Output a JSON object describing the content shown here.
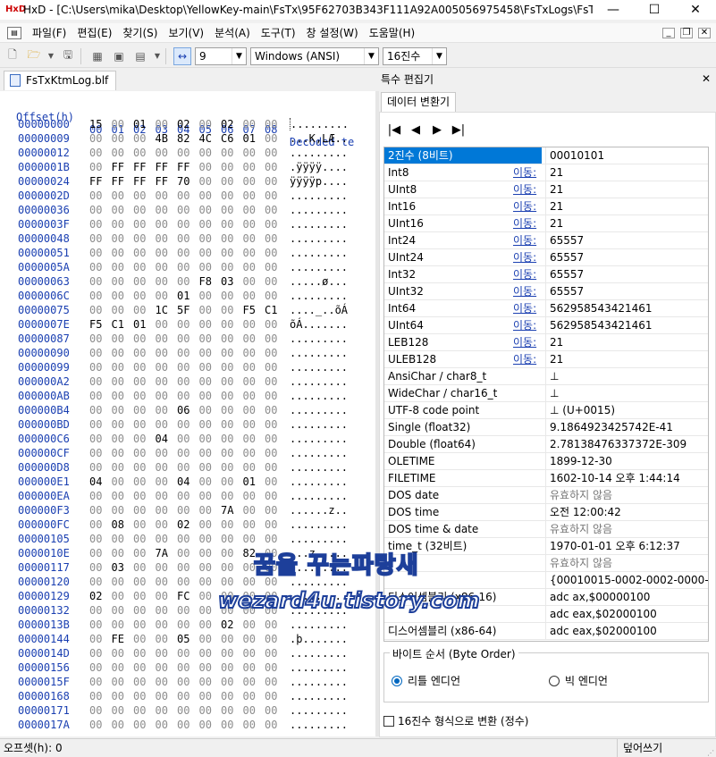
{
  "window": {
    "title": "HxD - [C:\\Users\\mika\\Desktop\\YellowKey-main\\FsTx\\95F62703B343F111A92A005056975458\\FsTxLogs\\FsTxKtmLog.blf]",
    "app_icon_label": "HxD",
    "minimize_glyph": "—",
    "maximize_glyph": "☐",
    "close_glyph": "✕"
  },
  "menu": {
    "items": [
      "파일(F)",
      "편집(E)",
      "찾기(S)",
      "보기(V)",
      "분석(A)",
      "도구(T)",
      "창 설정(W)",
      "도움말(H)"
    ],
    "mdi": [
      "_",
      "❐",
      "✕"
    ]
  },
  "toolbar": {
    "bytes_per_row": "9",
    "charset": "Windows (ANSI)",
    "offset_base": "16진수"
  },
  "document": {
    "tab_label": "FsTxKtmLog.blf"
  },
  "hex": {
    "header_offset": "Offset(h)",
    "header_columns": [
      "00",
      "01",
      "02",
      "03",
      "04",
      "05",
      "06",
      "07",
      "08"
    ],
    "header_decoded": "Decoded te",
    "rows": [
      {
        "o": "00000000",
        "b": [
          "15",
          "00",
          "01",
          "00",
          "02",
          "00",
          "02",
          "00",
          "00"
        ],
        "t": "........."
      },
      {
        "o": "00000009",
        "b": [
          "00",
          "00",
          "00",
          "4B",
          "82",
          "4C",
          "C6",
          "01",
          "00"
        ],
        "t": "...K,LÆ.."
      },
      {
        "o": "00000012",
        "b": [
          "00",
          "00",
          "00",
          "00",
          "00",
          "00",
          "00",
          "00",
          "00"
        ],
        "t": "........."
      },
      {
        "o": "0000001B",
        "b": [
          "00",
          "FF",
          "FF",
          "FF",
          "FF",
          "00",
          "00",
          "00",
          "00"
        ],
        "t": ".ÿÿÿÿ...."
      },
      {
        "o": "00000024",
        "b": [
          "FF",
          "FF",
          "FF",
          "FF",
          "70",
          "00",
          "00",
          "00",
          "00"
        ],
        "t": "ÿÿÿÿp...."
      },
      {
        "o": "0000002D",
        "b": [
          "00",
          "00",
          "00",
          "00",
          "00",
          "00",
          "00",
          "00",
          "00"
        ],
        "t": "........."
      },
      {
        "o": "00000036",
        "b": [
          "00",
          "00",
          "00",
          "00",
          "00",
          "00",
          "00",
          "00",
          "00"
        ],
        "t": "........."
      },
      {
        "o": "0000003F",
        "b": [
          "00",
          "00",
          "00",
          "00",
          "00",
          "00",
          "00",
          "00",
          "00"
        ],
        "t": "........."
      },
      {
        "o": "00000048",
        "b": [
          "00",
          "00",
          "00",
          "00",
          "00",
          "00",
          "00",
          "00",
          "00"
        ],
        "t": "........."
      },
      {
        "o": "00000051",
        "b": [
          "00",
          "00",
          "00",
          "00",
          "00",
          "00",
          "00",
          "00",
          "00"
        ],
        "t": "........."
      },
      {
        "o": "0000005A",
        "b": [
          "00",
          "00",
          "00",
          "00",
          "00",
          "00",
          "00",
          "00",
          "00"
        ],
        "t": "........."
      },
      {
        "o": "00000063",
        "b": [
          "00",
          "00",
          "00",
          "00",
          "00",
          "F8",
          "03",
          "00",
          "00"
        ],
        "t": ".....ø..."
      },
      {
        "o": "0000006C",
        "b": [
          "00",
          "00",
          "00",
          "00",
          "01",
          "00",
          "00",
          "00",
          "00"
        ],
        "t": "........."
      },
      {
        "o": "00000075",
        "b": [
          "00",
          "00",
          "00",
          "1C",
          "5F",
          "00",
          "00",
          "F5",
          "C1"
        ],
        "t": "...._..õÁ"
      },
      {
        "o": "0000007E",
        "b": [
          "F5",
          "C1",
          "01",
          "00",
          "00",
          "00",
          "00",
          "00",
          "00"
        ],
        "t": "õÁ......."
      },
      {
        "o": "00000087",
        "b": [
          "00",
          "00",
          "00",
          "00",
          "00",
          "00",
          "00",
          "00",
          "00"
        ],
        "t": "........."
      },
      {
        "o": "00000090",
        "b": [
          "00",
          "00",
          "00",
          "00",
          "00",
          "00",
          "00",
          "00",
          "00"
        ],
        "t": "........."
      },
      {
        "o": "00000099",
        "b": [
          "00",
          "00",
          "00",
          "00",
          "00",
          "00",
          "00",
          "00",
          "00"
        ],
        "t": "........."
      },
      {
        "o": "000000A2",
        "b": [
          "00",
          "00",
          "00",
          "00",
          "00",
          "00",
          "00",
          "00",
          "00"
        ],
        "t": "........."
      },
      {
        "o": "000000AB",
        "b": [
          "00",
          "00",
          "00",
          "00",
          "00",
          "00",
          "00",
          "00",
          "00"
        ],
        "t": "........."
      },
      {
        "o": "000000B4",
        "b": [
          "00",
          "00",
          "00",
          "00",
          "06",
          "00",
          "00",
          "00",
          "00"
        ],
        "t": "........."
      },
      {
        "o": "000000BD",
        "b": [
          "00",
          "00",
          "00",
          "00",
          "00",
          "00",
          "00",
          "00",
          "00"
        ],
        "t": "........."
      },
      {
        "o": "000000C6",
        "b": [
          "00",
          "00",
          "00",
          "04",
          "00",
          "00",
          "00",
          "00",
          "00"
        ],
        "t": "........."
      },
      {
        "o": "000000CF",
        "b": [
          "00",
          "00",
          "00",
          "00",
          "00",
          "00",
          "00",
          "00",
          "00"
        ],
        "t": "........."
      },
      {
        "o": "000000D8",
        "b": [
          "00",
          "00",
          "00",
          "00",
          "00",
          "00",
          "00",
          "00",
          "00"
        ],
        "t": "........."
      },
      {
        "o": "000000E1",
        "b": [
          "04",
          "00",
          "00",
          "00",
          "04",
          "00",
          "00",
          "01",
          "00"
        ],
        "t": "........."
      },
      {
        "o": "000000EA",
        "b": [
          "00",
          "00",
          "00",
          "00",
          "00",
          "00",
          "00",
          "00",
          "00"
        ],
        "t": "........."
      },
      {
        "o": "000000F3",
        "b": [
          "00",
          "00",
          "00",
          "00",
          "00",
          "00",
          "7A",
          "00",
          "00"
        ],
        "t": "......z.."
      },
      {
        "o": "000000FC",
        "b": [
          "00",
          "08",
          "00",
          "00",
          "02",
          "00",
          "00",
          "00",
          "00"
        ],
        "t": "........."
      },
      {
        "o": "00000105",
        "b": [
          "00",
          "00",
          "00",
          "00",
          "00",
          "00",
          "00",
          "00",
          "00"
        ],
        "t": "........."
      },
      {
        "o": "0000010E",
        "b": [
          "00",
          "00",
          "00",
          "7A",
          "00",
          "00",
          "00",
          "82",
          "00"
        ],
        "t": "...z....."
      },
      {
        "o": "00000117",
        "b": [
          "00",
          "03",
          "00",
          "00",
          "00",
          "00",
          "00",
          "00",
          "00"
        ],
        "t": "........."
      },
      {
        "o": "00000120",
        "b": [
          "00",
          "00",
          "00",
          "00",
          "00",
          "00",
          "00",
          "00",
          "00"
        ],
        "t": "........."
      },
      {
        "o": "00000129",
        "b": [
          "02",
          "00",
          "00",
          "00",
          "FC",
          "00",
          "00",
          "00",
          "00"
        ],
        "t": "........."
      },
      {
        "o": "00000132",
        "b": [
          "00",
          "00",
          "00",
          "00",
          "00",
          "00",
          "00",
          "00",
          "00"
        ],
        "t": "........."
      },
      {
        "o": "0000013B",
        "b": [
          "00",
          "00",
          "00",
          "00",
          "00",
          "00",
          "02",
          "00",
          "00"
        ],
        "t": "........."
      },
      {
        "o": "00000144",
        "b": [
          "00",
          "FE",
          "00",
          "00",
          "05",
          "00",
          "00",
          "00",
          "00"
        ],
        "t": ".þ......."
      },
      {
        "o": "0000014D",
        "b": [
          "00",
          "00",
          "00",
          "00",
          "00",
          "00",
          "00",
          "00",
          "00"
        ],
        "t": "........."
      },
      {
        "o": "00000156",
        "b": [
          "00",
          "00",
          "00",
          "00",
          "00",
          "00",
          "00",
          "00",
          "00"
        ],
        "t": "........."
      },
      {
        "o": "0000015F",
        "b": [
          "00",
          "00",
          "00",
          "00",
          "00",
          "00",
          "00",
          "00",
          "00"
        ],
        "t": "........."
      },
      {
        "o": "00000168",
        "b": [
          "00",
          "00",
          "00",
          "00",
          "00",
          "00",
          "00",
          "00",
          "00"
        ],
        "t": "........."
      },
      {
        "o": "00000171",
        "b": [
          "00",
          "00",
          "00",
          "00",
          "00",
          "00",
          "00",
          "00",
          "00"
        ],
        "t": "........."
      },
      {
        "o": "0000017A",
        "b": [
          "00",
          "00",
          "00",
          "00",
          "00",
          "00",
          "00",
          "00",
          "00"
        ],
        "t": "........."
      }
    ]
  },
  "special_editor": {
    "title": "특수 편집기",
    "close_glyph": "✕",
    "tab_label": "데이터 변환기",
    "nav": [
      "|◀",
      "◀",
      "▶",
      "▶|"
    ],
    "rows": [
      {
        "label": "2진수 (8비트)",
        "move": "",
        "value": "00010101",
        "selected": true
      },
      {
        "label": "Int8",
        "move": "이동:",
        "value": "21"
      },
      {
        "label": "UInt8",
        "move": "이동:",
        "value": "21"
      },
      {
        "label": "Int16",
        "move": "이동:",
        "value": "21"
      },
      {
        "label": "UInt16",
        "move": "이동:",
        "value": "21"
      },
      {
        "label": "Int24",
        "move": "이동:",
        "value": "65557"
      },
      {
        "label": "UInt24",
        "move": "이동:",
        "value": "65557"
      },
      {
        "label": "Int32",
        "move": "이동:",
        "value": "65557"
      },
      {
        "label": "UInt32",
        "move": "이동:",
        "value": "65557"
      },
      {
        "label": "Int64",
        "move": "이동:",
        "value": "562958543421461"
      },
      {
        "label": "UInt64",
        "move": "이동:",
        "value": "562958543421461"
      },
      {
        "label": "LEB128",
        "move": "이동:",
        "value": "21"
      },
      {
        "label": "ULEB128",
        "move": "이동:",
        "value": "21"
      },
      {
        "label": "AnsiChar / char8_t",
        "move": "",
        "value": "⊥"
      },
      {
        "label": "WideChar / char16_t",
        "move": "",
        "value": "⊥"
      },
      {
        "label": "UTF-8 code point",
        "move": "",
        "value": "⊥ (U+0015)"
      },
      {
        "label": "Single (float32)",
        "move": "",
        "value": "9.1864923425742E-41"
      },
      {
        "label": "Double (float64)",
        "move": "",
        "value": "2.78138476337372E-309"
      },
      {
        "label": "OLETIME",
        "move": "",
        "value": "1899-12-30"
      },
      {
        "label": "FILETIME",
        "move": "",
        "value": "1602-10-14 오후 1:44:14"
      },
      {
        "label": "DOS date",
        "move": "",
        "value": "유효하지 않음",
        "dim": true
      },
      {
        "label": "DOS time",
        "move": "",
        "value": "오전 12:00:42"
      },
      {
        "label": "DOS time & date",
        "move": "",
        "value": "유효하지 않음",
        "dim": true
      },
      {
        "label": "time_t (32비트)",
        "move": "",
        "value": "1970-01-01 오후 6:12:37"
      },
      {
        "label": "",
        "move": "",
        "value": "유효하지 않음",
        "dim": true
      },
      {
        "label": "",
        "move": "",
        "value": "{00010015-0002-0002-0000-00"
      },
      {
        "label": "디스어셈블리 (x86-16)",
        "move": "",
        "value": "adc ax,$00000100"
      },
      {
        "label": "",
        "move": "",
        "value": "adc eax,$02000100"
      },
      {
        "label": "디스어셈블리 (x86-64)",
        "move": "",
        "value": "adc eax,$02000100"
      }
    ],
    "byte_order": {
      "legend": "바이트 순서 (Byte Order)",
      "little": "리틀 엔디언",
      "big": "빅 엔디언",
      "selected": "little"
    },
    "hex_format_checkbox": "16진수 형식으로 변환 (정수)"
  },
  "status": {
    "offset": "오프셋(h): 0",
    "mode": "덮어쓰기"
  },
  "watermark": {
    "line1": "꿈을 꾸는파랑새",
    "line2": "wezard4u.tistory.com"
  }
}
